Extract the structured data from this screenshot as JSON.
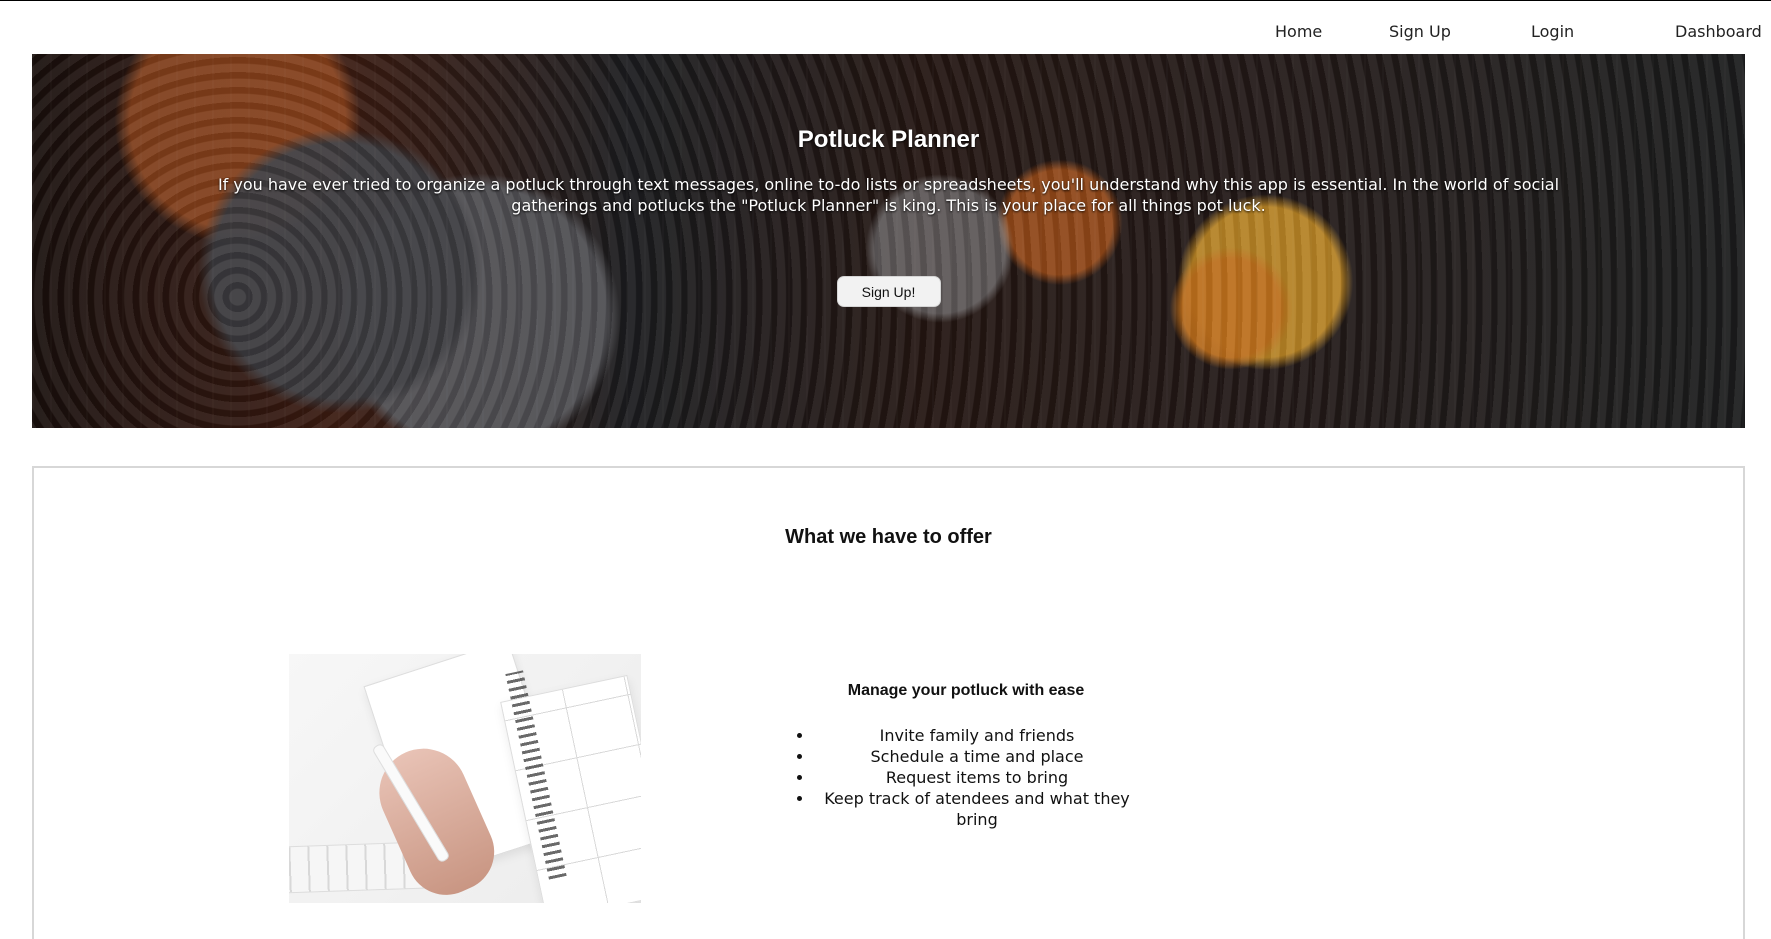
{
  "nav": {
    "items": [
      "Home",
      "Sign Up",
      "Login",
      "Dashboard"
    ]
  },
  "hero": {
    "title": "Potluck Planner",
    "description": "If you have ever tried to organize a potluck through text messages, online to-do lists or spreadsheets, you'll understand why this app is essential. In the world of social gatherings and potlucks the \"Potluck Planner\" is king. This is your place for all things pot luck.",
    "button_label": "Sign Up!"
  },
  "offer": {
    "title": "What we have to offer",
    "feature_title": "Manage your potluck with ease",
    "features": [
      "Invite family and friends",
      "Schedule a time and place",
      "Request items to bring",
      "Keep track of atendees and what they bring"
    ]
  },
  "icons": {
    "bullet": "bullet-icon"
  },
  "colors": {
    "hero_button_background": "#f2f2f2",
    "section_border": "#d7d7d7"
  }
}
